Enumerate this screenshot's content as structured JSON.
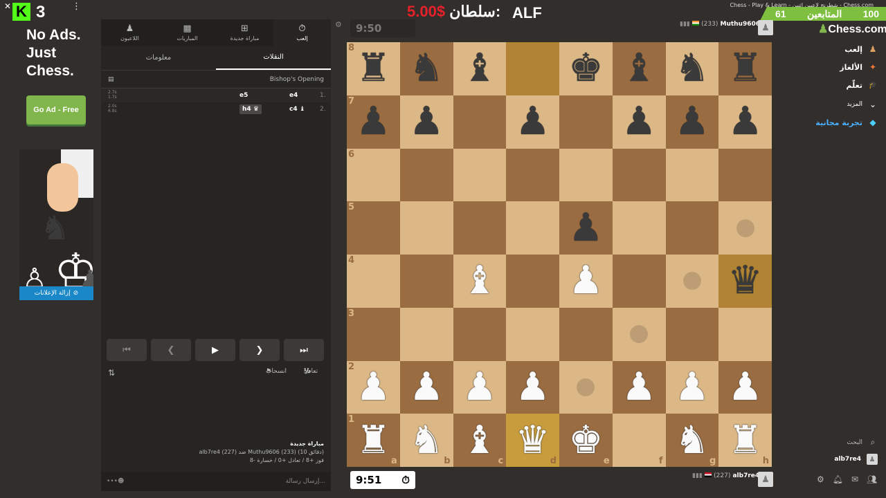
{
  "overlay": {
    "kick_logo": "K",
    "kick_count": "3",
    "close_glyph": "✕",
    "menu_glyph": "⋮",
    "sultan_label": "سلطان:",
    "sultan_amount": "5.00$",
    "streamer_name": "ALF",
    "window_title": "Chess - Play & Learn - شطرنج لاعبين اثنين - Chess.com",
    "followers_label": "المتابعين",
    "followers_count": "61",
    "followers_goal": "100"
  },
  "ad": {
    "headline_1": "No Ads.",
    "headline_2": "Just",
    "headline_3": "Chess.",
    "cta": "Go Ad - Free",
    "remove_ads": "إزالة الإعلانات"
  },
  "panel": {
    "tabs": [
      {
        "label": "اللاعبون",
        "icon": "♟"
      },
      {
        "label": "المباريات",
        "icon": "▦"
      },
      {
        "label": "مباراة جديدة",
        "icon": "⊞"
      },
      {
        "label": "إلعب",
        "icon": "⏱"
      }
    ],
    "subtabs": [
      "معلومات",
      "النقلات"
    ],
    "opening": "Bishop's Opening",
    "moves": [
      {
        "num": "1.",
        "white": "e4",
        "black": "e5",
        "t1": "2.7s",
        "t2": "1.7s"
      },
      {
        "num": "2.",
        "white": "c4",
        "black": "h4",
        "t1": "2.0s",
        "t2": "6.8s"
      }
    ],
    "draw_label": "تعادل",
    "resign_label": "انسحاب",
    "half": "½",
    "chat_title": "مباراة جديدة",
    "chat_players_line": "alb7re4 (227) ضد Muthu9606 (233) (10 دقائق)",
    "chat_result_line": "فوز +8 / تعادل +0 / خسارة -8",
    "chat_placeholder": "إرسال رسالة..."
  },
  "top_player": {
    "name": "Muthu9606",
    "rating": "(233)",
    "clock": "9:50"
  },
  "bottom_player": {
    "name": "alb7re4",
    "rating": "(227)",
    "clock": "9:51"
  },
  "board": {
    "ranks": [
      "8",
      "7",
      "6",
      "5",
      "4",
      "3",
      "2",
      "1"
    ],
    "files": [
      "a",
      "b",
      "c",
      "d",
      "e",
      "f",
      "g",
      "h"
    ],
    "position": [
      "rnb.kbnr",
      "pp.p.ppp",
      "........",
      "....p...",
      "..B.P..q",
      "........",
      "PPPP.PPP",
      "RNBQK.NR"
    ],
    "highlighted": [
      "d8",
      "h4",
      "d1"
    ],
    "move_dots": [
      "h5",
      "g4",
      "f3",
      "e2"
    ]
  },
  "nav": {
    "logo_text": "Chess.com",
    "items": [
      {
        "label": "إلعب",
        "icon": "♟"
      },
      {
        "label": "الألغاز",
        "icon": "✦"
      },
      {
        "label": "تعلّم",
        "icon": "🎓"
      },
      {
        "label": "المزيد",
        "icon": "⌄"
      },
      {
        "label": "تجربة مجانية",
        "icon": "◆"
      }
    ],
    "search_label": "البحث",
    "user_label": "alb7re4"
  }
}
